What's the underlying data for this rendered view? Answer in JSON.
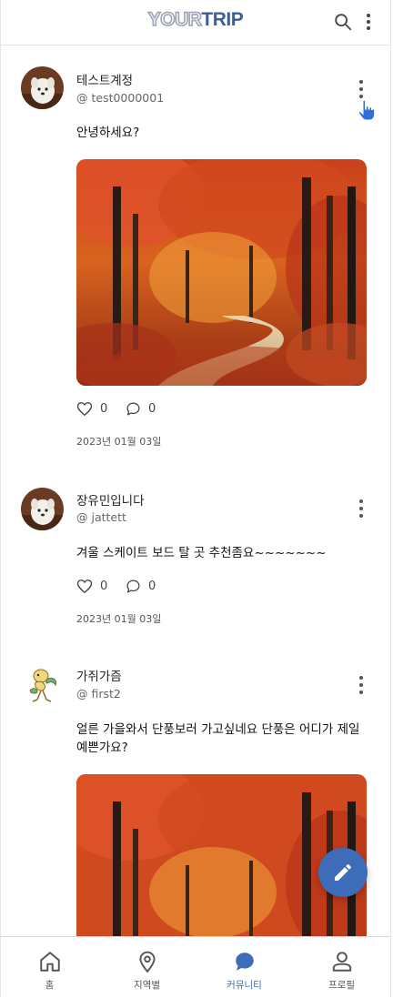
{
  "app": {
    "logo_part1": "YOUR",
    "logo_part2": "TRIP",
    "brand_color": "#3c5f94",
    "accent_color": "#3d6cb9"
  },
  "posts": [
    {
      "author": "테스트계정",
      "handle": "@ test0000001",
      "text": "안녕하세요?",
      "has_image": true,
      "likes": "0",
      "comments": "0",
      "date": "2023년 01월 03일"
    },
    {
      "author": "장유민입니다",
      "handle": "@ jattett",
      "text": "겨울 스케이트 보드 탈 곳 추천좀요~~~~~~~",
      "has_image": false,
      "likes": "0",
      "comments": "0",
      "date": "2023년 01월 03일"
    },
    {
      "author": "가쥐가즘",
      "handle": "@ first2",
      "text": "얼른 가을와서 단풍보러 가고싶네요 단풍은 어디가 제일 예쁜가요?",
      "has_image": true
    }
  ],
  "nav": {
    "items": [
      {
        "label": "홈",
        "icon": "home-icon",
        "active": false
      },
      {
        "label": "지역별",
        "icon": "map-pin-icon",
        "active": false
      },
      {
        "label": "커뮤니티",
        "icon": "chat-icon",
        "active": true
      },
      {
        "label": "프로필",
        "icon": "profile-icon",
        "active": false
      }
    ]
  },
  "fab": {
    "icon": "pencil-icon"
  }
}
